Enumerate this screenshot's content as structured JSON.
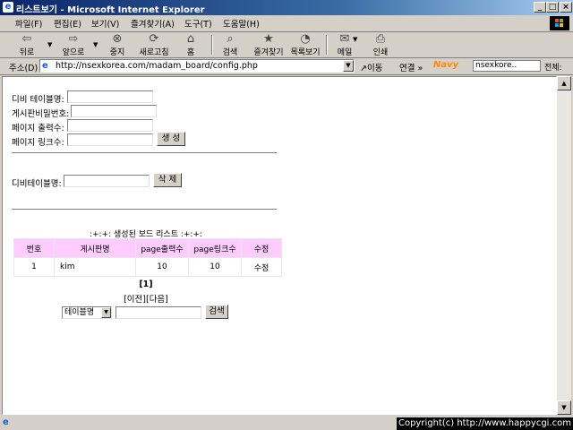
{
  "window": {
    "title": "리스트보기 - Microsoft Internet Explorer",
    "minimize": "_",
    "maximize": "□",
    "close": "×"
  },
  "menu": [
    "파일(F)",
    "편집(E)",
    "보기(V)",
    "즐겨찾기(A)",
    "도구(T)",
    "도움말(H)"
  ],
  "toolbar": {
    "back": "뒤로",
    "forward": "앞으로",
    "stop": "중지",
    "refresh": "새로고침",
    "home": "홈",
    "search": "검색",
    "favorites": "즐겨찾기",
    "history": "목록보기",
    "mail": "메일",
    "print": "인쇄"
  },
  "address": {
    "label": "주소(D)",
    "url": "http://nsexkorea.com/madam_board/config.php",
    "go": "이동",
    "links": "연결 »",
    "search_value": "nsexkore..",
    "search_all": "전체:"
  },
  "form": {
    "db_table_label": "디비 테이블명:",
    "board_password_label": "게시판비밀번호:",
    "page_output_label": "페이지 출력수:",
    "page_link_label": "페이지 링크수:",
    "create_button": "생 성",
    "delete_label": "디비테이블명:",
    "delete_button": "삭 제"
  },
  "board_list": {
    "title": ":+:+: 생성된 보드 리스트 :+:+:",
    "headers": [
      "번호",
      "게시판명",
      "page출력수",
      "page링크수",
      "수정"
    ],
    "rows": [
      [
        "1",
        "kim",
        "10",
        "10",
        "수정"
      ]
    ],
    "pager": "[1]",
    "nav": "[이전][다음]",
    "search_field": "테이블명",
    "search_button": "검색"
  },
  "status": {
    "copyright": "Copyright(c) http://www.happycgi.com"
  }
}
